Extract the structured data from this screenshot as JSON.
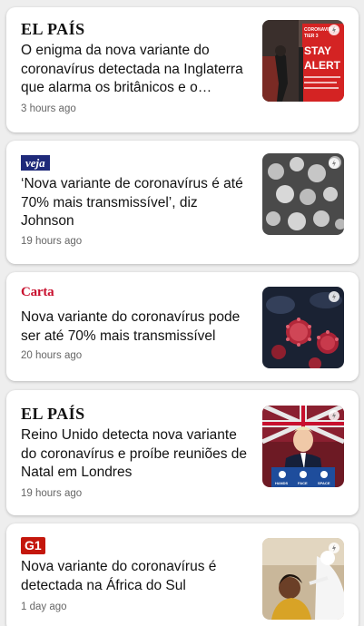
{
  "articles": [
    {
      "source": "EL PAÍS",
      "headline": "O enigma da nova variante do coronavírus detectada na Inglaterra que alarma os britânicos e o…",
      "time": "3 hours ago",
      "thumbnail_text": "CORONAVIRUS TIER 3 STAY ALERT"
    },
    {
      "source": "veja",
      "headline": "‘Nova variante de coronavírus é até 70% mais transmissível’, diz Johnson",
      "time": "19 hours ago"
    },
    {
      "source": "Carta",
      "headline": "Nova variante do coronavírus pode ser até 70% mais transmissível",
      "time": "20 hours ago"
    },
    {
      "source": "EL PAÍS",
      "headline": "Reino Unido detecta nova variante do coronavírus e proíbe reuniões de Natal em Londres",
      "time": "19 hours ago",
      "thumbnail_text": "HANDS FACE SPACE"
    },
    {
      "source": "G1",
      "headline": "Nova variante do coronavírus é detectada na África do Sul",
      "time": "1 day ago"
    }
  ]
}
